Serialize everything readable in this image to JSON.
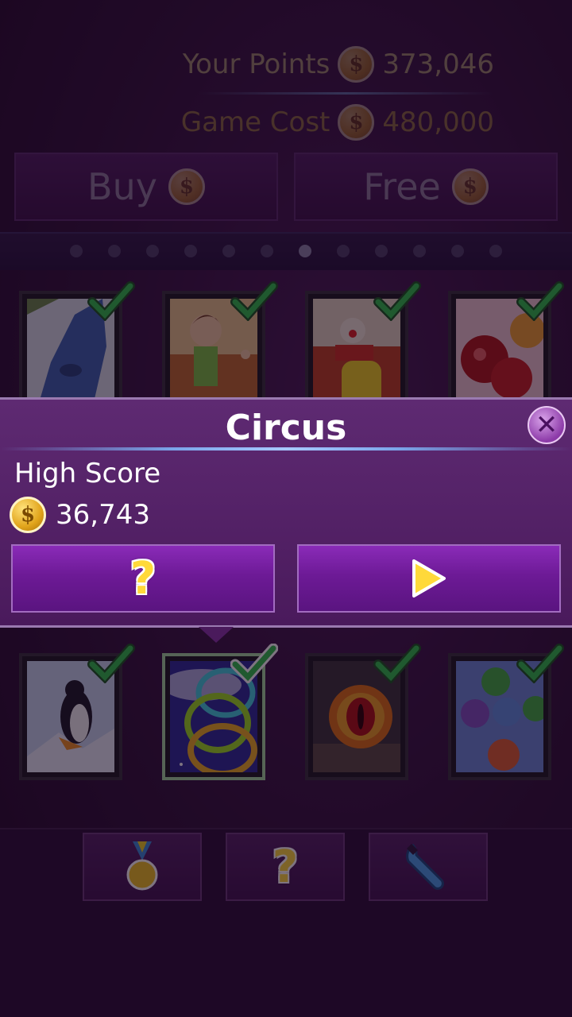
{
  "header": {
    "points_label": "Your Points",
    "points_value": "373,046",
    "cost_label": "Game Cost",
    "cost_value": "480,000",
    "coin_symbol": "$"
  },
  "top_buttons": {
    "buy_label": "Buy",
    "free_label": "Free"
  },
  "pager": {
    "page_count": 12,
    "active_page": 7
  },
  "games_top_row": [
    {
      "name": "ice-slope",
      "unlocked": true
    },
    {
      "name": "kids-running",
      "unlocked": true
    },
    {
      "name": "clown",
      "unlocked": true
    },
    {
      "name": "boxing",
      "unlocked": true
    }
  ],
  "games_bottom_row": [
    {
      "name": "penguin",
      "unlocked": true
    },
    {
      "name": "circus-rings",
      "unlocked": true,
      "selected": true
    },
    {
      "name": "eye",
      "unlocked": true
    },
    {
      "name": "bubbles",
      "unlocked": true
    }
  ],
  "popup": {
    "title": "Circus",
    "high_score_label": "High Score",
    "high_score_value": "36,743",
    "help_symbol": "?",
    "close_symbol": "✕"
  },
  "bottom_bar": {
    "help_symbol": "?"
  },
  "colors": {
    "check_green": "#2fc14a",
    "popup_purple": "#5e2a72",
    "button_purple": "#7a1fa8",
    "accent_yellow": "#ffd93a"
  }
}
